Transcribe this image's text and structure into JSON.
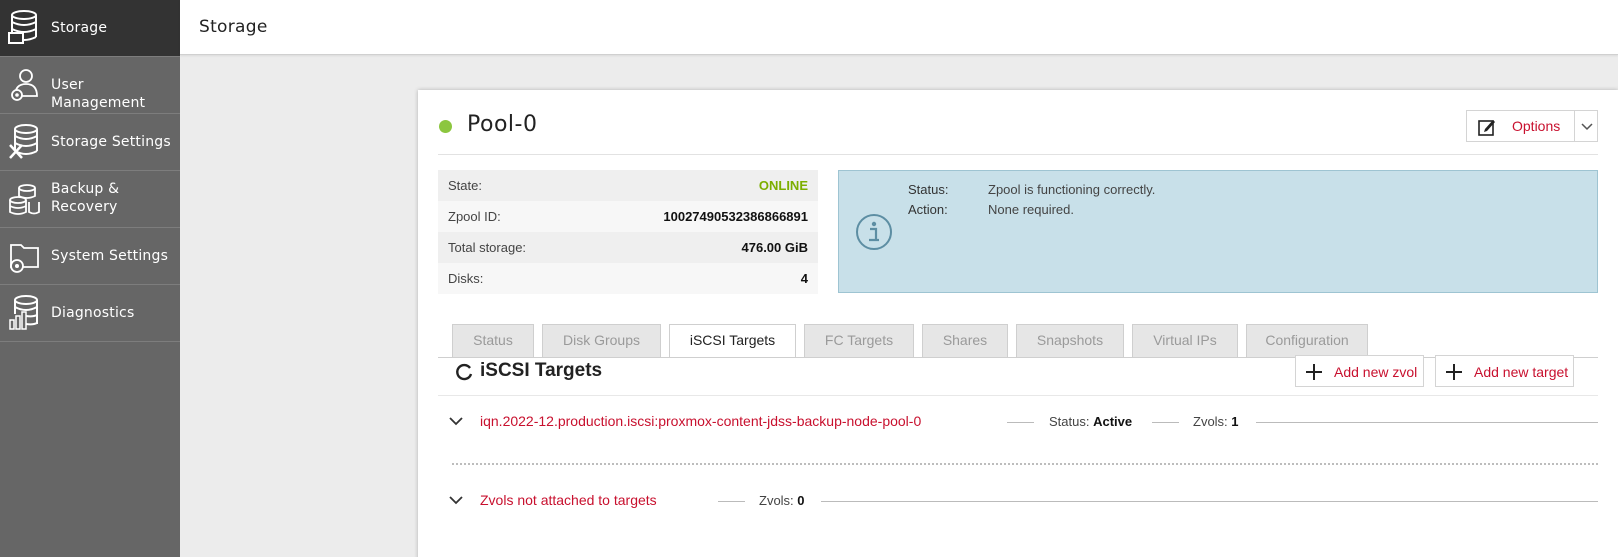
{
  "sidebar": {
    "items": [
      {
        "label": "Storage",
        "icon": "database-icon",
        "active": true
      },
      {
        "label": "User Management",
        "icon": "user-gear-icon",
        "active": false
      },
      {
        "label": "Storage Settings",
        "icon": "database-tools-icon",
        "active": false
      },
      {
        "label": "Backup & Recovery",
        "icon": "backup-coins-icon",
        "active": false
      },
      {
        "label": "System Settings",
        "icon": "folder-gear-icon",
        "active": false
      },
      {
        "label": "Diagnostics",
        "icon": "database-chart-icon",
        "active": false
      }
    ]
  },
  "header": {
    "title": "Storage"
  },
  "pool": {
    "name": "Pool-0",
    "status_color": "#8cc63f",
    "options_label": "Options",
    "info": [
      {
        "label": "State:",
        "value": "ONLINE"
      },
      {
        "label": "Zpool ID:",
        "value": "10027490532386866891"
      },
      {
        "label": "Total storage:",
        "value": "476.00 GiB"
      },
      {
        "label": "Disks:",
        "value": "4"
      }
    ],
    "status_box": {
      "status_key": "Status:",
      "status_value": "Zpool is functioning correctly.",
      "action_key": "Action:",
      "action_value": "None required."
    }
  },
  "tabs": [
    {
      "label": "Status",
      "active": false
    },
    {
      "label": "Disk Groups",
      "active": false
    },
    {
      "label": "iSCSI Targets",
      "active": true
    },
    {
      "label": "FC Targets",
      "active": false
    },
    {
      "label": "Shares",
      "active": false
    },
    {
      "label": "Snapshots",
      "active": false
    },
    {
      "label": "Virtual IPs",
      "active": false
    },
    {
      "label": "Configuration",
      "active": false
    }
  ],
  "iscsi": {
    "title": "iSCSI Targets",
    "add_zvol_label": "Add new zvol",
    "add_target_label": "Add new target",
    "targets": [
      {
        "name": "iqn.2022-12.production.iscsi:proxmox-content-jdss-backup-node-pool-0",
        "status_key": "Status:",
        "status_value": "Active",
        "zvols_key": "Zvols:",
        "zvols_value": "1"
      }
    ],
    "unattached": {
      "name": "Zvols not attached to targets",
      "zvols_key": "Zvols:",
      "zvols_value": "0"
    }
  },
  "colors": {
    "accent": "#c8102e",
    "online": "#7cae00",
    "sidebar": "#666666",
    "sidebar_active": "#333333"
  }
}
